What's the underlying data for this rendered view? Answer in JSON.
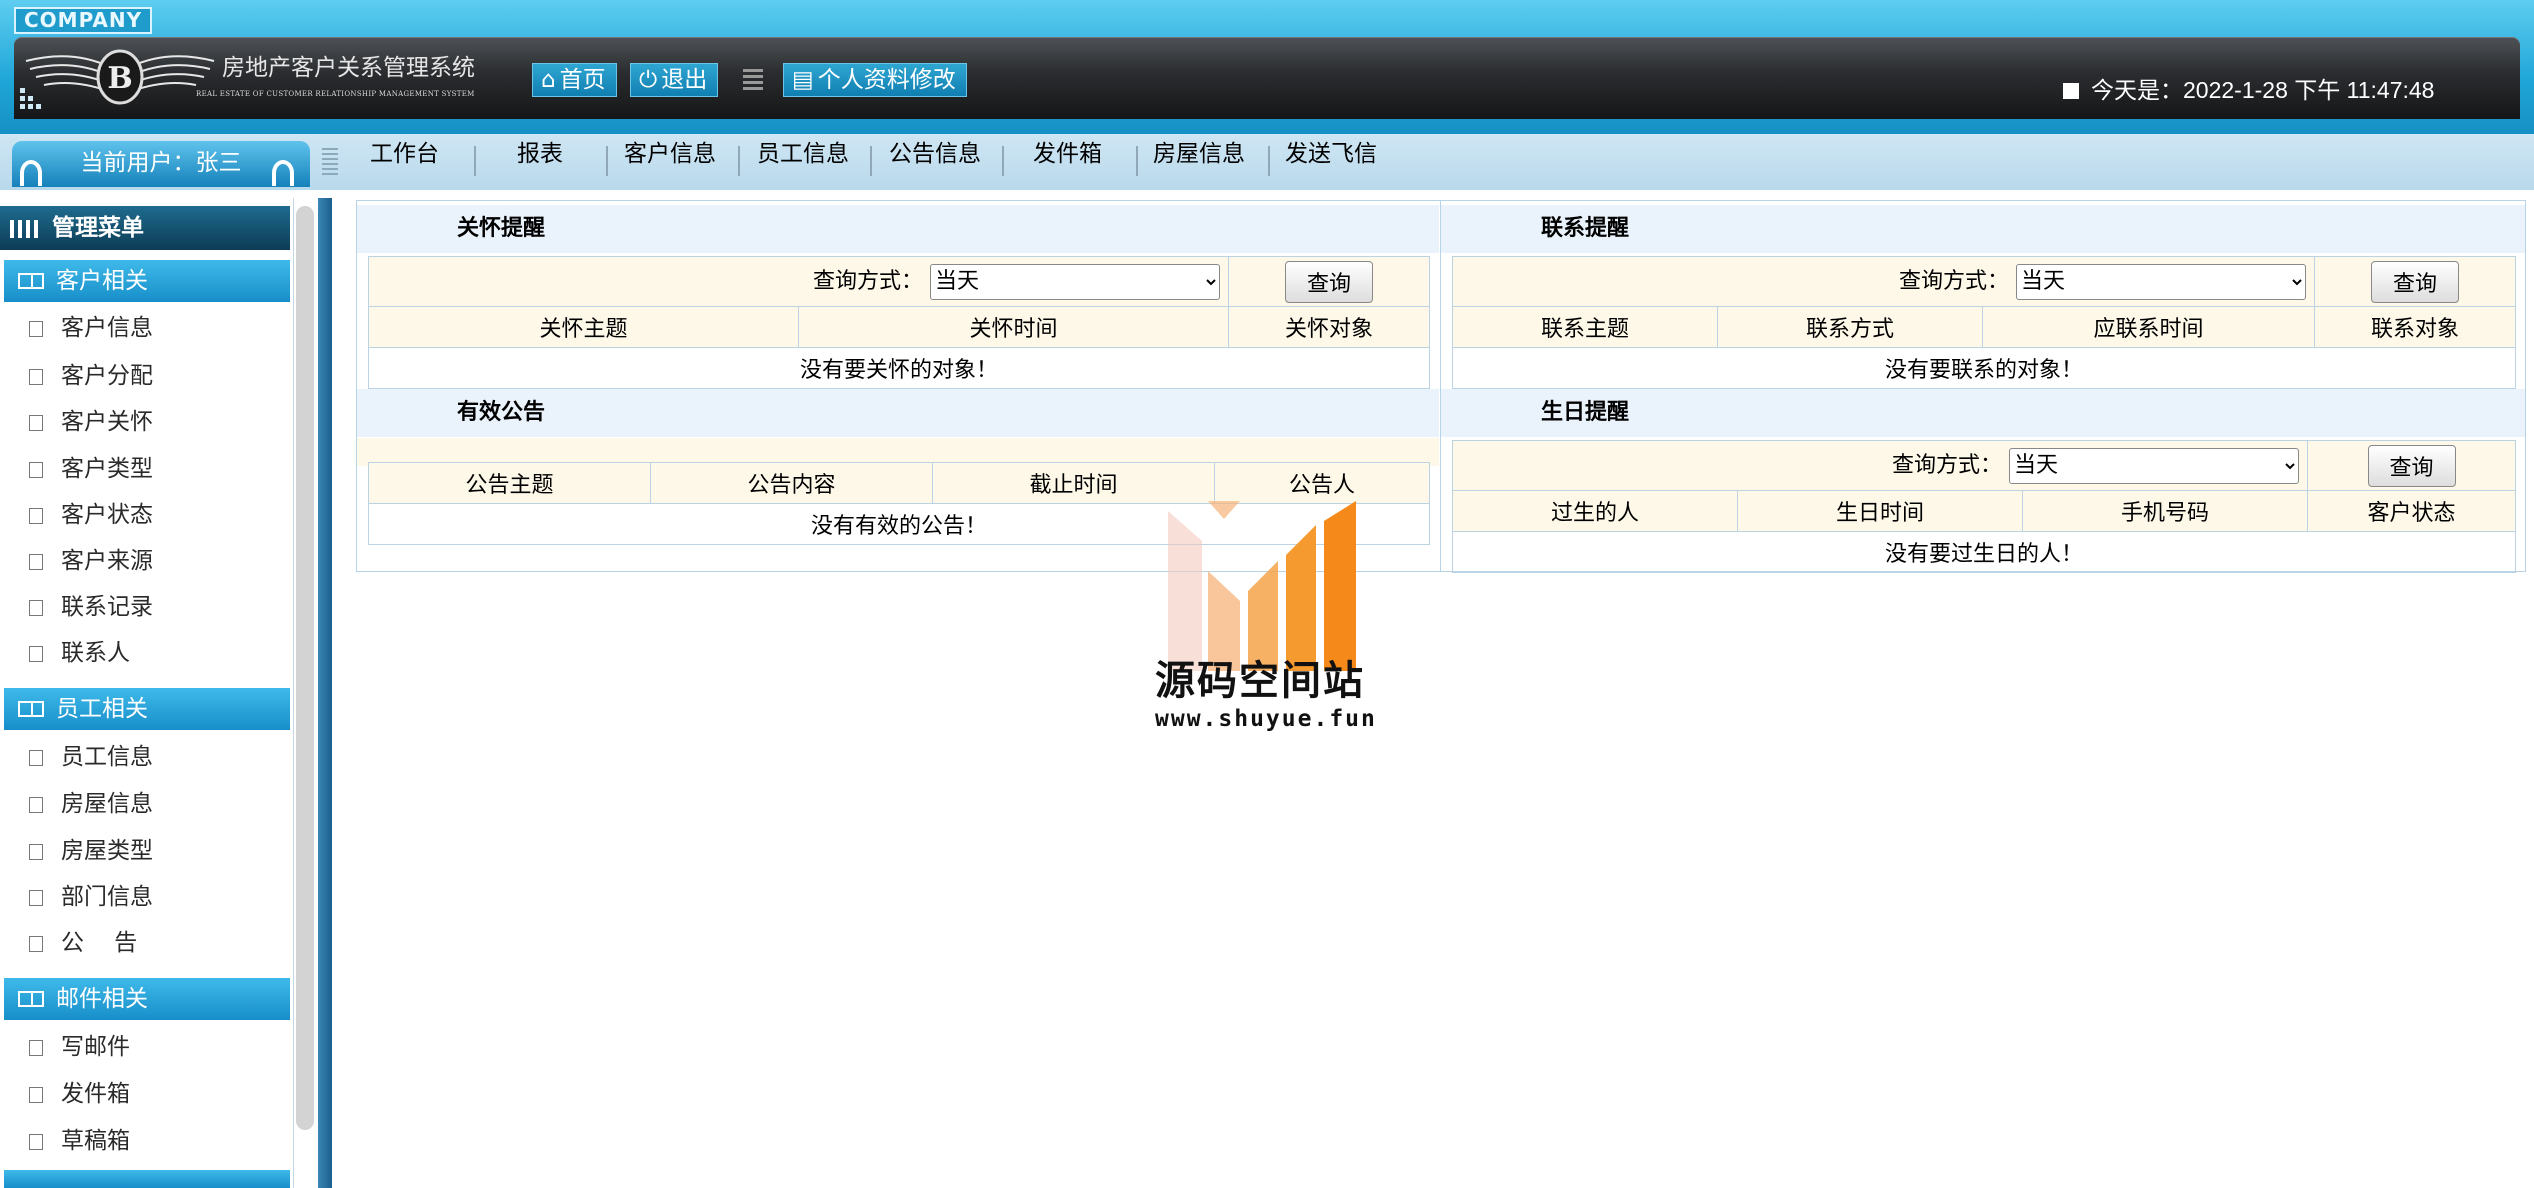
{
  "header": {
    "company_logo_text": "COMPANY",
    "system_title": "房地产客户关系管理系统",
    "system_subtitle": "REAL ESTATE OF CUSTOMER RELATIONSHIP MANAGEMENT SYSTEM",
    "home_label": "首页",
    "logout_label": "退出",
    "profile_label": "个人资料修改",
    "date_text": "今天是：2022-1-28 下午 11:47:48"
  },
  "nav": {
    "current_user": "当前用户：张三",
    "items": [
      {
        "label": "工作台"
      },
      {
        "label": "报表"
      },
      {
        "label": "客户信息"
      },
      {
        "label": "员工信息"
      },
      {
        "label": "公告信息"
      },
      {
        "label": "发件箱"
      },
      {
        "label": "房屋信息"
      },
      {
        "label": "发送飞信"
      }
    ]
  },
  "sidebar": {
    "title": "管理菜单",
    "groups": [
      {
        "label": "客户相关",
        "items": [
          {
            "label": "客户信息"
          },
          {
            "label": "客户分配"
          },
          {
            "label": "客户关怀"
          },
          {
            "label": "客户类型"
          },
          {
            "label": "客户状态"
          },
          {
            "label": "客户来源"
          },
          {
            "label": "联系记录"
          },
          {
            "label": "联系人"
          }
        ]
      },
      {
        "label": "员工相关",
        "items": [
          {
            "label": "员工信息"
          },
          {
            "label": "房屋信息"
          },
          {
            "label": "房屋类型"
          },
          {
            "label": "部门信息"
          },
          {
            "label": "公　 告"
          }
        ]
      },
      {
        "label": "邮件相关",
        "items": [
          {
            "label": "写邮件"
          },
          {
            "label": "发件箱"
          },
          {
            "label": "草稿箱"
          }
        ]
      }
    ]
  },
  "care_panel": {
    "title": "关怀提醒",
    "query_label": "查询方式：",
    "select_value": "当天",
    "button_label": "查询",
    "columns": [
      "关怀主题",
      "关怀时间",
      "关怀对象"
    ],
    "empty_text": "没有要关怀的对象！"
  },
  "contact_panel": {
    "title": "联系提醒",
    "query_label": "查询方式：",
    "select_value": "当天",
    "button_label": "查询",
    "columns": [
      "联系主题",
      "联系方式",
      "应联系时间",
      "联系对象"
    ],
    "empty_text": "没有要联系的对象！"
  },
  "notice_panel": {
    "title": "有效公告",
    "columns": [
      "公告主题",
      "公告内容",
      "截止时间",
      "公告人"
    ],
    "empty_text": "没有有效的公告！"
  },
  "birthday_panel": {
    "title": "生日提醒",
    "query_label": "查询方式：",
    "select_value": "当天",
    "button_label": "查询",
    "columns": [
      "过生的人",
      "生日时间",
      "手机号码",
      "客户状态"
    ],
    "empty_text": "没有要过生日的人！"
  },
  "watermark": {
    "title": "源码空间站",
    "url": "www.shuyue.fun"
  },
  "colors": {
    "header_blue": "#1fa6d8",
    "banner_dark": "#2a2c2f",
    "group_blue": "#178ec9",
    "menu_dark": "#0d3c55",
    "table_header_bg": "#fdf8e8",
    "watermark_orange": "#f59a2e"
  }
}
